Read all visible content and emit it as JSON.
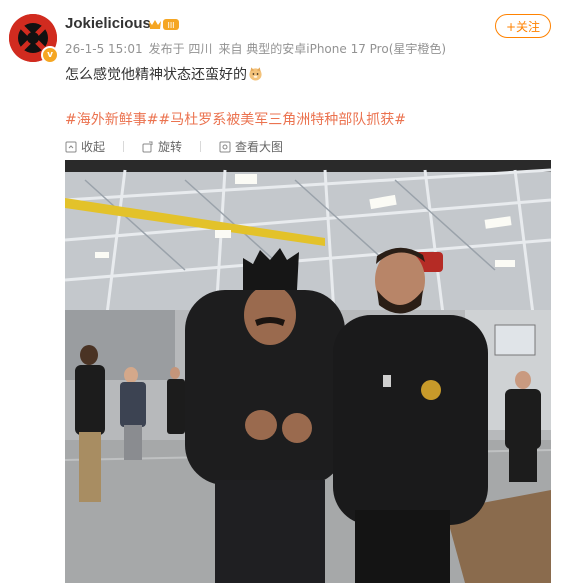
{
  "user": {
    "name": "Jokielicious",
    "level_badge": "III",
    "verify_badge": "v"
  },
  "meta": {
    "timestamp": "26-1-5 15:01",
    "location": "发布于 四川",
    "source": "来自 典型的安卓iPhone 17 Pro(星宇橙色)"
  },
  "follow_label": "+关注",
  "post": {
    "text": "怎么感觉他精神状态还蛮好的",
    "emoji": "doge-emoji",
    "topics": [
      "#海外新鲜事#",
      "#马杜罗系被美军三角洲特种部队抓获#"
    ]
  },
  "toolbar": {
    "collapse": "收起",
    "rotate": "旋转",
    "view_large": "查看大图"
  },
  "colors": {
    "accent": "#ff8200",
    "topic": "#eb7350",
    "meta": "#939393"
  }
}
